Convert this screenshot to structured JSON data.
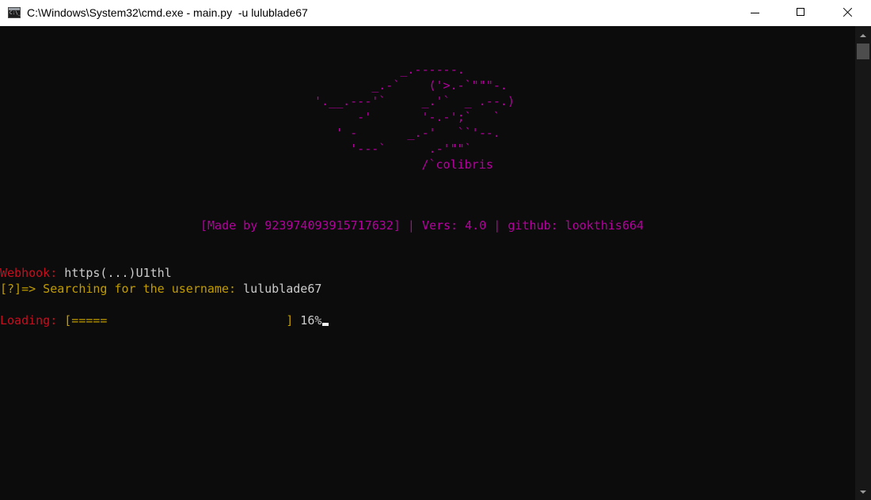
{
  "window": {
    "title": "C:\\Windows\\System32\\cmd.exe - main.py  -u lulublade67",
    "icon": "command-prompt-icon",
    "controls": [
      "minimize-icon",
      "maximize-icon",
      "close-icon"
    ]
  },
  "colors": {
    "background": "#0c0c0c",
    "magenta": "#b4009e",
    "red": "#c50f1f",
    "yellow": "#c19c00",
    "text": "#cccccc"
  },
  "banner": {
    "ascii_art": "            _.------.\n        _.-`    ('>.-`\"\"\"-.\n'.__.---'`     _.'`  _ .--.)\n      -'       '-.-';`   `\n   ' -       _.-'   ``'--.\n     '---`      .-'\"\"`\n               /`colibris",
    "credits": "[Made by 923974093915717632] | Vers: 4.0 | github: lookthis664"
  },
  "output": {
    "webhook_label": "Webhook: ",
    "webhook_value": "https(...)U1thl",
    "search_prompt": "[?]=> Searching for the username: ",
    "search_username": "lulublade67",
    "loading_label": "Loading: ",
    "loading_bar": "[=====                         ]",
    "loading_percent": " 16%",
    "progress": 0.16
  }
}
